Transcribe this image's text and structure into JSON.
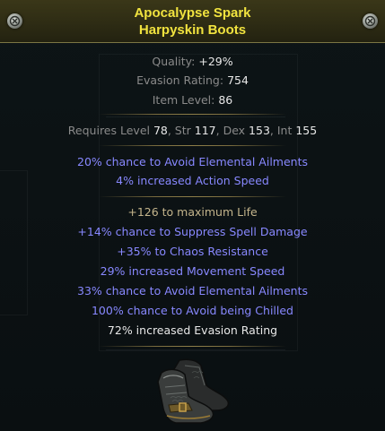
{
  "item": {
    "name": "Apocalypse Spark",
    "base": "Harpyskin Boots",
    "icon": "harpyskin-boots-icon",
    "rarity_color": "#f1e33f"
  },
  "properties": {
    "quality_label": "Quality: ",
    "quality_value": "+29%",
    "evasion_label": "Evasion Rating: ",
    "evasion_value": "754",
    "item_level_label": "Item Level: ",
    "item_level_value": "86"
  },
  "requirements": {
    "prefix": "Requires Level ",
    "level": "78",
    "str_label": ", Str ",
    "str": "117",
    "dex_label": ", Dex ",
    "dex": "153",
    "int_label": ", Int ",
    "int": "155"
  },
  "enchants": [
    "20% chance to Avoid Elemental Ailments",
    "4% increased Action Speed"
  ],
  "explicit_mods": [
    "+126 to maximum Life",
    "+14% chance to Suppress Spell Damage",
    "+35% to Chaos Resistance",
    "29% increased Movement Speed",
    "33% chance to Avoid Elemental Ailments",
    "100% chance to Avoid being Chilled",
    "72% increased Evasion Rating"
  ],
  "colors": {
    "magic_mod": "#8888ff",
    "value_white": "#e8e8e8",
    "label_grey": "#8a8a8a",
    "crafted_mod": "#b8b2e6",
    "life_mod": "#c4b58c",
    "separator": "#8e7f49"
  }
}
